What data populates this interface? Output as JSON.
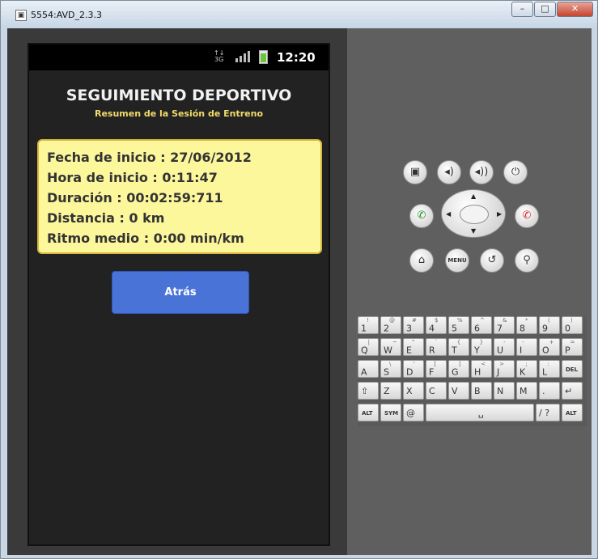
{
  "window": {
    "title": "5554:AVD_2.3.3",
    "minimize": "–",
    "maximize": "□",
    "close": "✕"
  },
  "statusbar": {
    "network": "3G",
    "time": "12:20"
  },
  "app": {
    "title": "SEGUIMIENTO DEPORTIVO",
    "subtitle": "Resumen de la Sesión de Entreno",
    "lines": [
      "Fecha de inicio : 27/06/2012",
      "Hora de inicio : 0:11:47",
      "Duración : 00:02:59:711",
      "Distancia : 0 km",
      "Ritmo medio : 0:00 min/km"
    ],
    "back_label": "Atrás"
  },
  "controls": {
    "camera": "▣",
    "vol_down": "◂)",
    "vol_up": "◂))",
    "power": "⏻",
    "call": "✆",
    "end_call": "✆",
    "home": "⌂",
    "menu": "MENU",
    "back": "↺",
    "search": "⚲"
  },
  "keyboard": {
    "row1": [
      [
        "1",
        "!"
      ],
      [
        "2",
        "@"
      ],
      [
        "3",
        "#"
      ],
      [
        "4",
        "$"
      ],
      [
        "5",
        "%"
      ],
      [
        "6",
        "^"
      ],
      [
        "7",
        "&"
      ],
      [
        "8",
        "*"
      ],
      [
        "9",
        "("
      ],
      [
        "0",
        ")"
      ]
    ],
    "row2": [
      [
        "Q",
        "|"
      ],
      [
        "W",
        "~"
      ],
      [
        "E",
        "\""
      ],
      [
        "R",
        "`"
      ],
      [
        "T",
        "{"
      ],
      [
        "Y",
        "}"
      ],
      [
        "U",
        "-"
      ],
      [
        "I",
        "-"
      ],
      [
        "O",
        "+"
      ],
      [
        "P",
        "="
      ]
    ],
    "row3": [
      [
        "A",
        ""
      ],
      [
        "S",
        "\\"
      ],
      [
        "D",
        "'"
      ],
      [
        "F",
        "["
      ],
      [
        "G",
        "]"
      ],
      [
        "H",
        "<"
      ],
      [
        "J",
        ">"
      ],
      [
        "K",
        ";"
      ],
      [
        "L",
        ":"
      ],
      [
        "DEL",
        ""
      ]
    ],
    "row4": [
      [
        "⇧",
        ""
      ],
      [
        "Z",
        ""
      ],
      [
        "X",
        ""
      ],
      [
        "C",
        ""
      ],
      [
        "V",
        ""
      ],
      [
        "B",
        ""
      ],
      [
        "N",
        ""
      ],
      [
        "M",
        ""
      ],
      [
        ".",
        ""
      ],
      [
        "↵",
        ""
      ]
    ],
    "row5": {
      "alt_left": "ALT",
      "sym": "SYM",
      "at": "@",
      "space": "␣",
      "slash": "/ ?",
      "comma": ",",
      "alt_right": "ALT"
    }
  }
}
